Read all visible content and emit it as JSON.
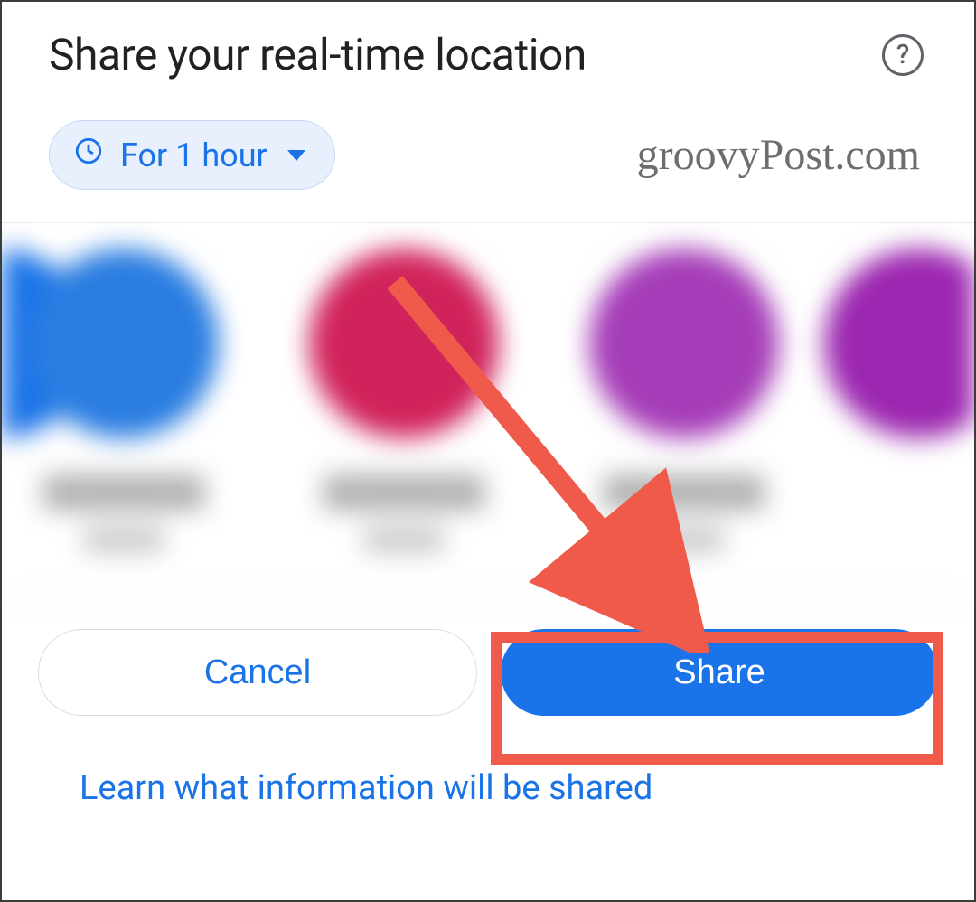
{
  "header": {
    "title": "Share your real-time location",
    "help_aria": "Help"
  },
  "duration": {
    "label": "For 1 hour",
    "icon": "clock-icon"
  },
  "watermark": "groovyPost.com",
  "contacts": [
    {
      "avatar_color": "#1a73e8"
    },
    {
      "avatar_color": "#2a7de1"
    },
    {
      "avatar_color": "#d1235b"
    },
    {
      "avatar_color": "#a63db8"
    },
    {
      "avatar_color": "#9c27b0"
    }
  ],
  "actions": {
    "cancel": "Cancel",
    "share": "Share"
  },
  "footer": {
    "learn_link": "Learn what information will be shared"
  },
  "annotation": {
    "highlight_target": "share-button",
    "arrow_color": "#f05a4a"
  }
}
